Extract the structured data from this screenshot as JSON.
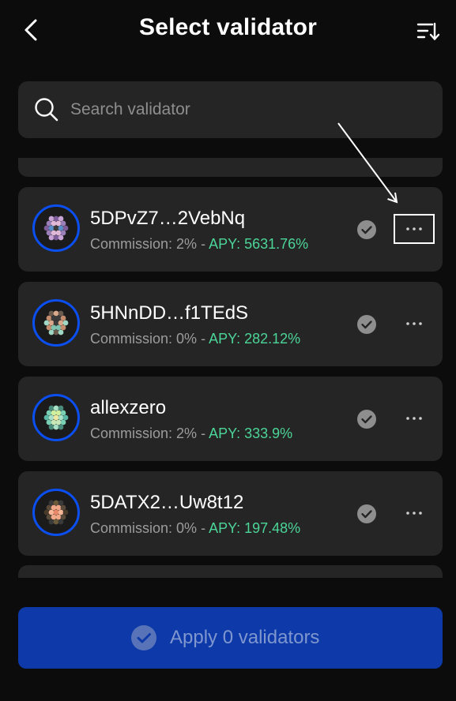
{
  "header": {
    "title": "Select validator",
    "back_icon": "chevron-left-icon",
    "sort_icon": "sort-icon"
  },
  "search": {
    "placeholder": "Search validator",
    "value": ""
  },
  "validators": [
    {
      "name": "5DPvZ7…2VebNq",
      "commission_label": "Commission: 2%",
      "separator": "-",
      "apy_label": "APY: 5631.76%"
    },
    {
      "name": "5HNnDD…f1TEdS",
      "commission_label": "Commission: 0%",
      "separator": "-",
      "apy_label": "APY: 282.12%"
    },
    {
      "name": "allexzero",
      "commission_label": "Commission: 2%",
      "separator": "-",
      "apy_label": "APY: 333.9%"
    },
    {
      "name": "5DATX2…Uw8t12",
      "commission_label": "Commission: 0%",
      "separator": "-",
      "apy_label": "APY: 197.48%"
    }
  ],
  "apply_button": {
    "label": "Apply 0 validators"
  },
  "colors": {
    "background": "#0c0c0c",
    "card": "#252525",
    "accent": "#0b4ff0",
    "apy": "#4cd598",
    "button": "#0d3aa8"
  }
}
